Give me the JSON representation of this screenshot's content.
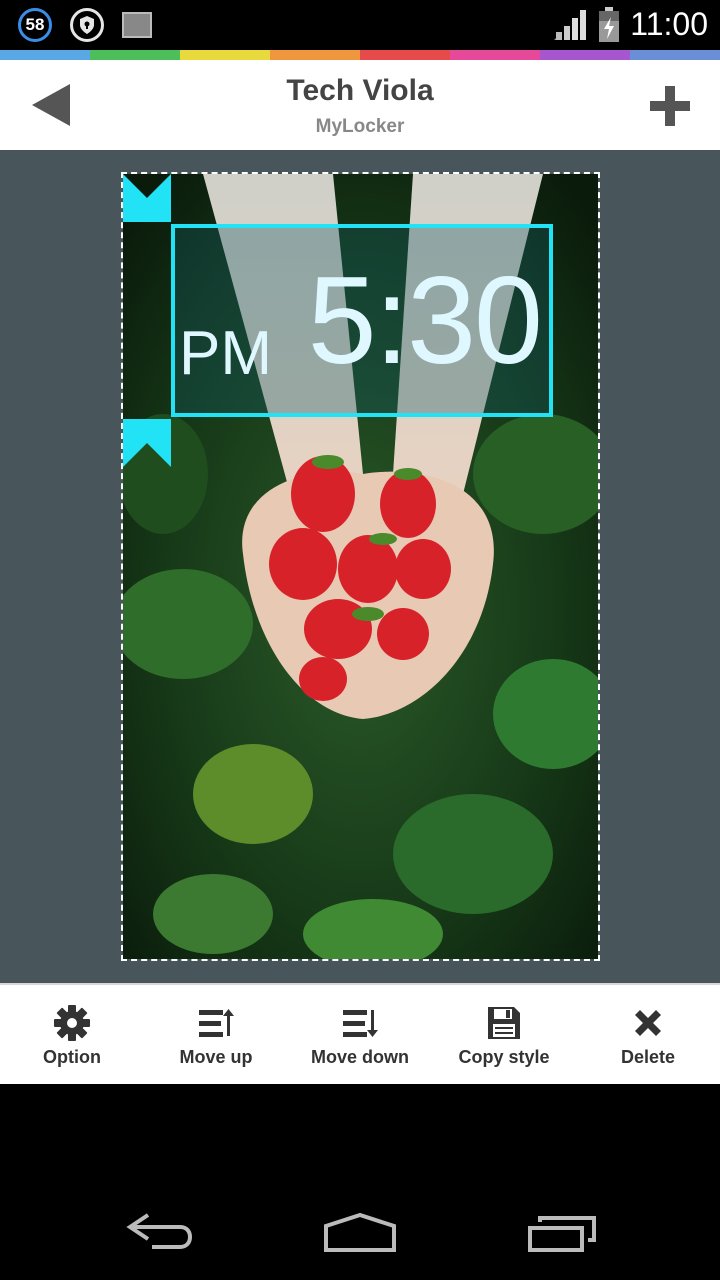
{
  "status_bar": {
    "notification_count": "58",
    "time": "11:00",
    "icons": [
      "notification-count-icon",
      "shield-icon",
      "image-icon",
      "signal-icon",
      "battery-icon"
    ]
  },
  "color_strip": [
    "#5aa7e6",
    "#4cbf5b",
    "#e8d93c",
    "#f0963c",
    "#e64a4a",
    "#e6489a",
    "#a657d0",
    "#6b8fd6"
  ],
  "header": {
    "title": "Tech Viola",
    "subtitle": "MyLocker"
  },
  "widget": {
    "ampm": "PM",
    "time": "5:30",
    "accent": "#22e3f5"
  },
  "toolbar": {
    "option": "Option",
    "move_up": "Move up",
    "move_down": "Move down",
    "copy_style": "Copy style",
    "delete": "Delete"
  }
}
